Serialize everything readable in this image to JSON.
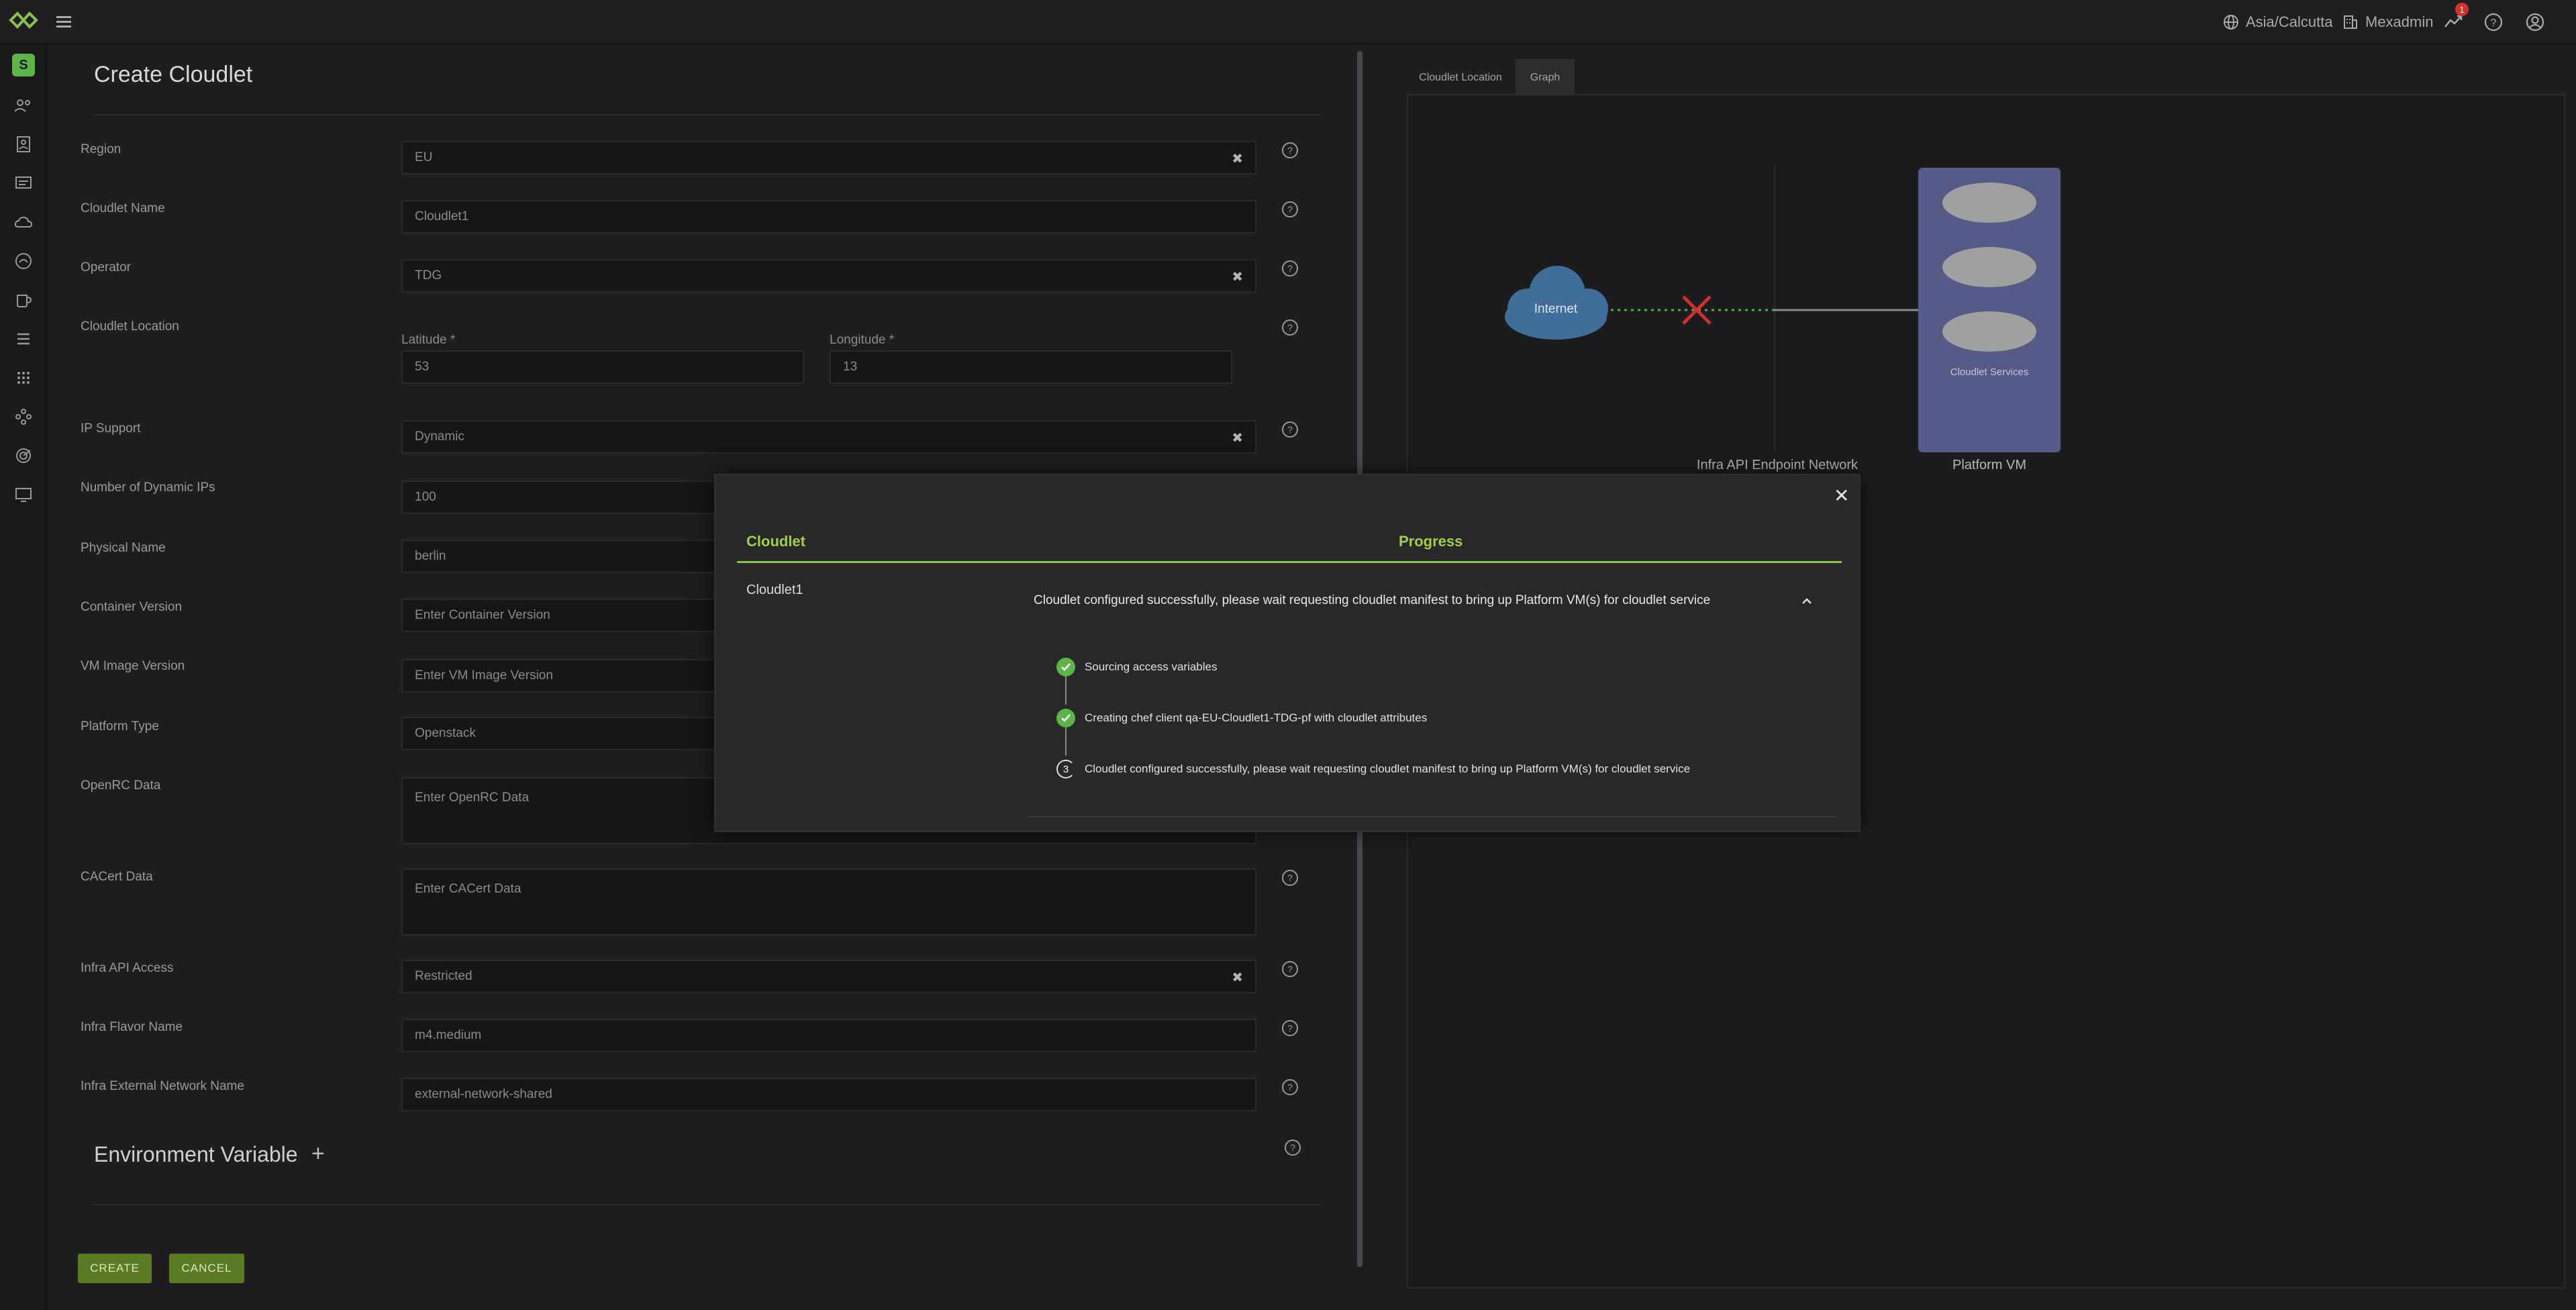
{
  "topbar": {
    "timezone": "Asia/Calcutta",
    "org": "Mexadmin",
    "alert_count": "1"
  },
  "sidebar": {
    "avatar_letter": "S"
  },
  "form": {
    "title": "Create Cloudlet",
    "fields": {
      "region": {
        "label": "Region",
        "value": "EU"
      },
      "cloudlet_name": {
        "label": "Cloudlet Name",
        "value": "Cloudlet1"
      },
      "operator": {
        "label": "Operator",
        "value": "TDG"
      },
      "cloudlet_location": {
        "label": "Cloudlet Location",
        "latitude_label": "Latitude *",
        "latitude": "53",
        "longitude_label": "Longitude *",
        "longitude": "13"
      },
      "ip_support": {
        "label": "IP Support",
        "value": "Dynamic"
      },
      "dynamic_ips": {
        "label": "Number of Dynamic IPs",
        "value": "100"
      },
      "physical_name": {
        "label": "Physical Name",
        "value": "berlin"
      },
      "container_version": {
        "label": "Container Version",
        "placeholder": "Enter Container Version"
      },
      "vm_image_version": {
        "label": "VM Image Version",
        "placeholder": "Enter VM Image Version"
      },
      "platform_type": {
        "label": "Platform Type",
        "value": "Openstack"
      },
      "openrc_data": {
        "label": "OpenRC Data",
        "placeholder": "Enter OpenRC Data"
      },
      "cacert_data": {
        "label": "CACert Data",
        "placeholder": "Enter CACert Data"
      },
      "infra_api_access": {
        "label": "Infra API Access",
        "value": "Restricted"
      },
      "infra_flavor_name": {
        "label": "Infra Flavor Name",
        "value": "m4.medium"
      },
      "infra_external_network": {
        "label": "Infra External Network Name",
        "value": "external-network-shared"
      }
    },
    "env_section_title": "Environment Variable",
    "create_label": "CREATE",
    "cancel_label": "CANCEL"
  },
  "graph_panel": {
    "tabs": [
      "Cloudlet Location",
      "Graph"
    ],
    "internet_label": "Internet",
    "network_label": "Infra API Endpoint Network",
    "platform_vm_label": "Platform VM",
    "services_label": "Cloudlet Services"
  },
  "modal": {
    "col_cloudlet": "Cloudlet",
    "col_progress": "Progress",
    "row_cloudlet": "Cloudlet1",
    "summary": "Cloudlet configured successfully, please wait requesting cloudlet manifest to bring up Platform VM(s) for cloudlet service",
    "steps": [
      {
        "text": "Sourcing access variables",
        "status": "done"
      },
      {
        "text": "Creating chef client qa-EU-Cloudlet1-TDG-pf with cloudlet attributes",
        "status": "done"
      },
      {
        "text": "Cloudlet configured successfully, please wait requesting cloudlet manifest to bring up Platform VM(s) for cloudlet service",
        "status": "in-progress",
        "number": "3"
      }
    ]
  },
  "colors": {
    "accent_green": "#8bc34a",
    "button_green": "#5a7a24",
    "cloud_blue": "#3f6e99",
    "vm_purple": "#565a86",
    "error_red": "#d0312d"
  }
}
